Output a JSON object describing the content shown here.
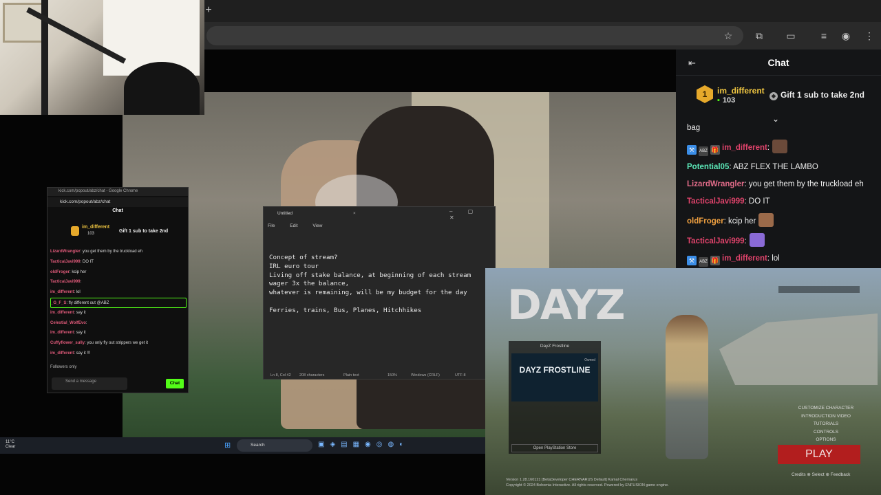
{
  "browser": {
    "new_tab_symbol": "+",
    "toolbar_icons": [
      "star-icon",
      "extension-icon",
      "cast-icon",
      "media-icon",
      "profile-icon",
      "menu-icon"
    ]
  },
  "popout": {
    "window_title": "kick.com/popout/abz/chat - Google Chrome",
    "url": "kick.com/popout/abz/chat",
    "header": "Chat",
    "pinned_user": "im_different",
    "pinned_count": "103",
    "pinned_gift": "Gift 1 sub to take 2nd",
    "lines": [
      {
        "user": "LizardWrangler",
        "text": ": you get them by the truckload eh"
      },
      {
        "user": "TacticalJavi999",
        "text": ": DO IT"
      },
      {
        "user": "oldFroger",
        "text": ": kcip her"
      },
      {
        "user": "TacticalJavi999",
        "text": ":"
      },
      {
        "user": "im_different",
        "text": ": lol"
      },
      {
        "user": "_G_F_S",
        "text": ": fly different out @ABZ"
      },
      {
        "user": "im_different",
        "text": ": say it"
      },
      {
        "user": "Celestial_WolfEvo",
        "text": ":"
      },
      {
        "user": "im_different",
        "text": ": say it"
      },
      {
        "user": "Cuffyflower_sully",
        "text": ": you only fly out strippers we get it"
      },
      {
        "user": "im_different",
        "text": ": say it !!!"
      }
    ],
    "followers_only": "Followers only",
    "input_placeholder": "Send a message",
    "send_label": "Chat"
  },
  "notepad": {
    "tab_title": "Untitled",
    "close_symbol": "×",
    "window_controls": "– ▢ ✕",
    "menu": [
      "File",
      "Edit",
      "View"
    ],
    "text": "Concept of stream?\nIRL euro tour\nLiving off stake balance, at beginning of each stream\nwager 3x the balance,\nwhatever is remaining, will be my budget for the day\n\nFerries, trains, Bus, Planes, Hitchhikes",
    "status": {
      "position": "Ln 8, Col 42",
      "chars": "208 characters",
      "format": "Plain text",
      "zoom": "150%",
      "eol": "Windows (CRLF)",
      "encoding": "UTF-8"
    }
  },
  "dayz": {
    "logo": "DAYZ",
    "panel_title": "DayZ Frostline",
    "panel_image_text": "DAYZ FROSTLINE",
    "panel_badge": "Owned",
    "store_label": "Open PlayStation Store",
    "menu_items": [
      "CUSTOMIZE CHARACTER",
      "INTRODUCTION VIDEO",
      "TUTORIALS",
      "CONTROLS",
      "OPTIONS"
    ],
    "play_label": "PLAY",
    "footer_line1": "Version 1.28.160121 [BetaDeveloper CHERNARUS Default] Kamal Chernarus",
    "footer_line2": "Copyright © 2024 Bohemia Interactive. All rights reserved. Powered by ENFUSION game engine.",
    "actions": "Credits ⊗ Select ⊕ Feedback"
  },
  "taskbar": {
    "temp": "11°C",
    "condition": "Clear",
    "search_label": "Search",
    "app_icons": "▣◈▤▦◉◎◍◐"
  },
  "chat": {
    "title": "Chat",
    "pinned": {
      "badge": "1",
      "user": "im_different",
      "count": "103",
      "gift": "Gift 1 sub to take 2nd"
    },
    "messages": [
      {
        "user": "",
        "color": "#eeeeee",
        "text": "bag",
        "badges": false
      },
      {
        "user": "im_different",
        "color": "#e0436b",
        "text": ":",
        "badges": true,
        "emote": "#6b4a3a"
      },
      {
        "user": "Potential05",
        "color": "#5ce8b8",
        "text": ": ABZ FLEX THE LAMBO",
        "badges": false
      },
      {
        "user": "LizardWrangler",
        "color": "#e06b88",
        "text": ": you get them by the truckload eh",
        "badges": false
      },
      {
        "user": "TacticalJavi999",
        "color": "#e0436b",
        "text": ": DO IT",
        "badges": false
      },
      {
        "user": "oldFroger",
        "color": "#f0a040",
        "text": ": kcip her",
        "badges": false,
        "emote": "#9b6a4a"
      },
      {
        "user": "TacticalJavi999",
        "color": "#e0436b",
        "text": ":",
        "badges": false,
        "emote": "#8a6ad6"
      },
      {
        "user": "im_different",
        "color": "#e0436b",
        "text": ": lol",
        "badges": true
      }
    ]
  }
}
